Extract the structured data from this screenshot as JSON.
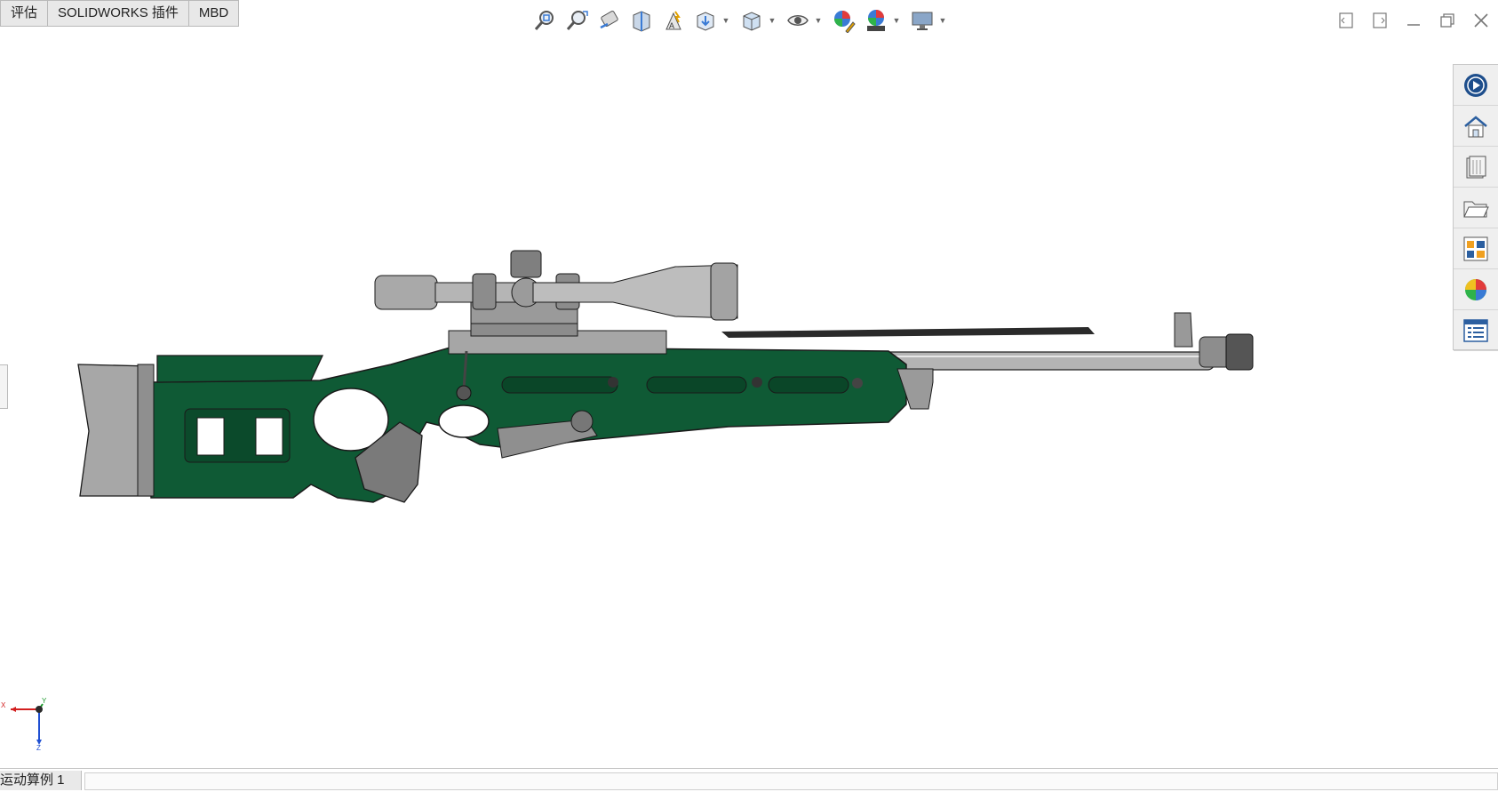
{
  "tabs": [
    "评估",
    "SOLIDWORKS 插件",
    "MBD"
  ],
  "heads_up_toolbar": [
    "zoom-to-fit-icon",
    "zoom-to-area-icon",
    "previous-view-icon",
    "section-view-icon",
    "dynamic-annotation-icon",
    "view-orientation-icon",
    "display-style-icon",
    "hide-show-items-icon",
    "edit-appearance-icon",
    "apply-scene-icon",
    "view-settings-icon"
  ],
  "window_controls": [
    "tile-left-icon",
    "tile-right-icon",
    "minimize-icon",
    "restore-icon",
    "close-icon"
  ],
  "task_pane": [
    "solidworks-resources-icon",
    "design-library-icon",
    "file-explorer-icon",
    "open-folder-icon",
    "view-palette-icon",
    "appearances-icon",
    "custom-properties-icon"
  ],
  "triad": {
    "x_label": "X",
    "y_label": "Y",
    "z_label": "Z"
  },
  "model": {
    "body_color": "#0f5a35",
    "metal_color": "#9c9c9c",
    "edge_color": "#1a1a1a"
  },
  "bottom_tab": "运动算例 1"
}
